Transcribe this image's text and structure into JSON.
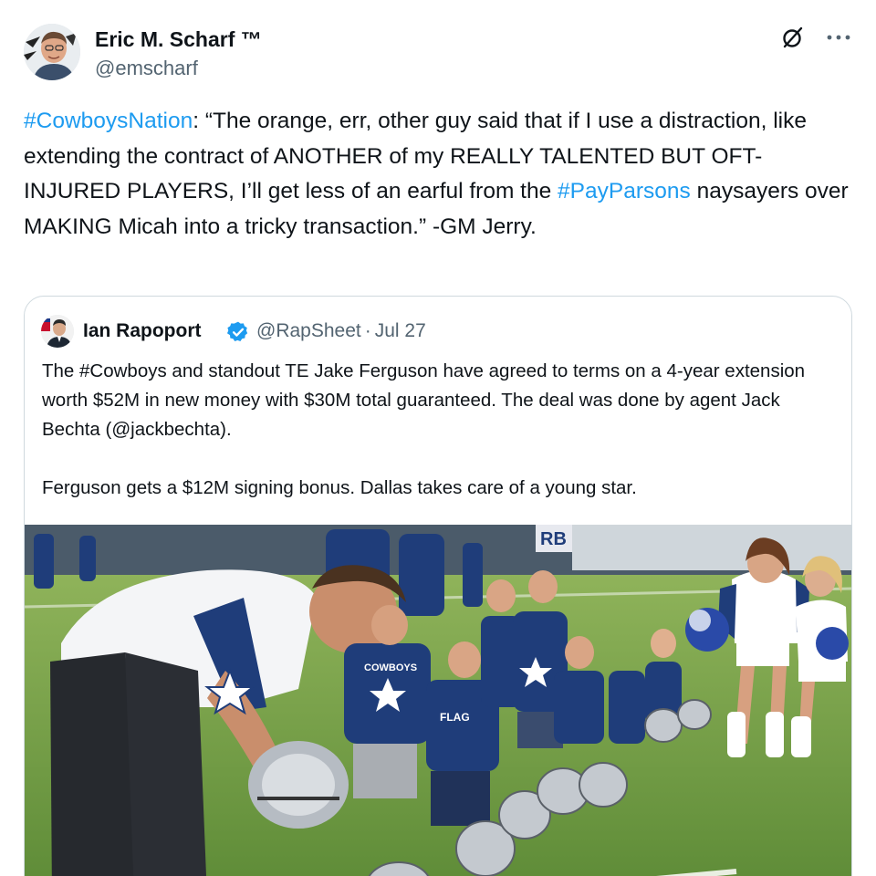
{
  "author": {
    "display_name": "Eric M. Scharf ™",
    "handle": "@emscharf",
    "avatar_icon": "user-avatar"
  },
  "actions": {
    "grok_icon": "slash-circle-icon",
    "more_icon": "more-horizontal-icon"
  },
  "tweet": {
    "hashtag_1": "#CowboysNation",
    "text_1": ": “The orange, err, other guy said that if I use a distraction, like extending the contract of ANOTHER of my REALLY TALENTED BUT OFT-INJURED PLAYERS, I’ll get less of an earful from the ",
    "hashtag_2": "#PayParsons",
    "text_2": " naysayers over MAKING Micah into a tricky transaction.” -GM Jerry."
  },
  "quote": {
    "display_name": "Ian Rapoport",
    "handle": "@RapSheet",
    "separator": "·",
    "date": "Jul 27",
    "paragraph_1": "The #Cowboys and standout TE Jake Ferguson have agreed to terms on a 4-year extension worth $52M in new money with $30M total guaranteed. The deal was done by agent Jack Bechta (@jackbechta).",
    "paragraph_2": "Ferguson gets a $12M signing bonus. Dallas takes care of a young star.",
    "photo_alt": "Cowboys player signing helmets for kids at training camp"
  },
  "colors": {
    "link": "#1d9bf0",
    "verified": "#1d9bf0",
    "secondary_text": "#536471",
    "border": "#cfd9de"
  }
}
